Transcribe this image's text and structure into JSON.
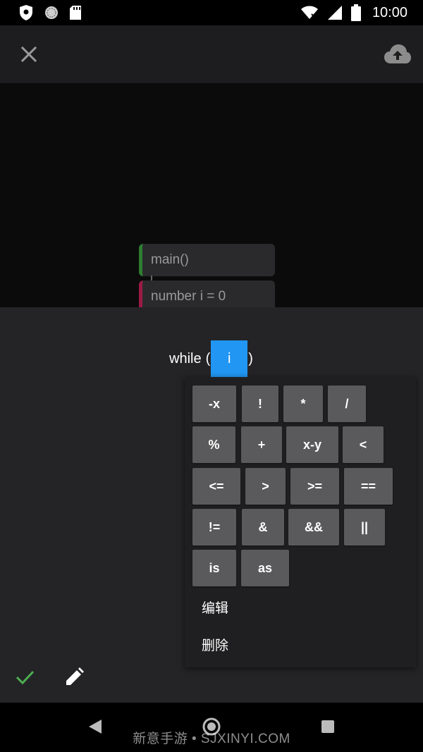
{
  "status_bar": {
    "time": "10:00",
    "left_icons": [
      "shield-icon",
      "circle-icon",
      "sd-card-icon"
    ],
    "right_icons": [
      "wifi-icon",
      "signal-icon",
      "battery-icon"
    ]
  },
  "app_bar": {
    "close_icon": "close-icon",
    "upload_icon": "cloud-upload-icon"
  },
  "canvas": {
    "blocks": [
      {
        "label": "main()",
        "accent": "#2e7d32"
      },
      {
        "label": "number i = 0",
        "accent": "#9b1b45"
      }
    ]
  },
  "expression": {
    "keyword": "while",
    "open_paren": "(",
    "slot_value": "i",
    "close_paren": ")",
    "slot_color": "#2196f3"
  },
  "operators": {
    "neg": "-x",
    "not": "!",
    "mul": "*",
    "div": "/",
    "mod": "%",
    "add": "+",
    "sub": "x-y",
    "lt": "<",
    "le": "<=",
    "gt": ">",
    "ge": ">=",
    "eq": "==",
    "ne": "!=",
    "band": "&",
    "and": "&&",
    "or": "||",
    "is": "is",
    "as": "as"
  },
  "menu": {
    "edit": "编辑",
    "delete": "删除"
  },
  "actions": {
    "confirm_icon": "check-icon",
    "edit_icon": "pencil-icon",
    "confirm_color": "#4caf50"
  },
  "nav_bar": {
    "icons": [
      "back-icon",
      "home-icon",
      "recent-apps-icon"
    ]
  },
  "watermark": "新意手游 • SJXINYI.COM"
}
